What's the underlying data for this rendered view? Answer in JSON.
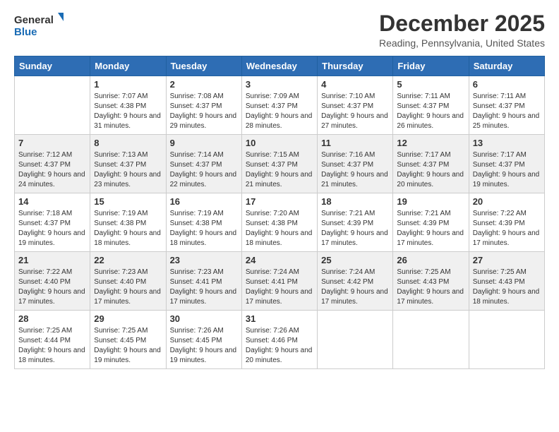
{
  "logo": {
    "line1": "General",
    "line2": "Blue"
  },
  "title": "December 2025",
  "location": "Reading, Pennsylvania, United States",
  "days_of_week": [
    "Sunday",
    "Monday",
    "Tuesday",
    "Wednesday",
    "Thursday",
    "Friday",
    "Saturday"
  ],
  "weeks": [
    [
      {
        "day": "",
        "sunrise": "",
        "sunset": "",
        "daylight": ""
      },
      {
        "day": "1",
        "sunrise": "Sunrise: 7:07 AM",
        "sunset": "Sunset: 4:38 PM",
        "daylight": "Daylight: 9 hours and 31 minutes."
      },
      {
        "day": "2",
        "sunrise": "Sunrise: 7:08 AM",
        "sunset": "Sunset: 4:37 PM",
        "daylight": "Daylight: 9 hours and 29 minutes."
      },
      {
        "day": "3",
        "sunrise": "Sunrise: 7:09 AM",
        "sunset": "Sunset: 4:37 PM",
        "daylight": "Daylight: 9 hours and 28 minutes."
      },
      {
        "day": "4",
        "sunrise": "Sunrise: 7:10 AM",
        "sunset": "Sunset: 4:37 PM",
        "daylight": "Daylight: 9 hours and 27 minutes."
      },
      {
        "day": "5",
        "sunrise": "Sunrise: 7:11 AM",
        "sunset": "Sunset: 4:37 PM",
        "daylight": "Daylight: 9 hours and 26 minutes."
      },
      {
        "day": "6",
        "sunrise": "Sunrise: 7:11 AM",
        "sunset": "Sunset: 4:37 PM",
        "daylight": "Daylight: 9 hours and 25 minutes."
      }
    ],
    [
      {
        "day": "7",
        "sunrise": "Sunrise: 7:12 AM",
        "sunset": "Sunset: 4:37 PM",
        "daylight": "Daylight: 9 hours and 24 minutes."
      },
      {
        "day": "8",
        "sunrise": "Sunrise: 7:13 AM",
        "sunset": "Sunset: 4:37 PM",
        "daylight": "Daylight: 9 hours and 23 minutes."
      },
      {
        "day": "9",
        "sunrise": "Sunrise: 7:14 AM",
        "sunset": "Sunset: 4:37 PM",
        "daylight": "Daylight: 9 hours and 22 minutes."
      },
      {
        "day": "10",
        "sunrise": "Sunrise: 7:15 AM",
        "sunset": "Sunset: 4:37 PM",
        "daylight": "Daylight: 9 hours and 21 minutes."
      },
      {
        "day": "11",
        "sunrise": "Sunrise: 7:16 AM",
        "sunset": "Sunset: 4:37 PM",
        "daylight": "Daylight: 9 hours and 21 minutes."
      },
      {
        "day": "12",
        "sunrise": "Sunrise: 7:17 AM",
        "sunset": "Sunset: 4:37 PM",
        "daylight": "Daylight: 9 hours and 20 minutes."
      },
      {
        "day": "13",
        "sunrise": "Sunrise: 7:17 AM",
        "sunset": "Sunset: 4:37 PM",
        "daylight": "Daylight: 9 hours and 19 minutes."
      }
    ],
    [
      {
        "day": "14",
        "sunrise": "Sunrise: 7:18 AM",
        "sunset": "Sunset: 4:37 PM",
        "daylight": "Daylight: 9 hours and 19 minutes."
      },
      {
        "day": "15",
        "sunrise": "Sunrise: 7:19 AM",
        "sunset": "Sunset: 4:38 PM",
        "daylight": "Daylight: 9 hours and 18 minutes."
      },
      {
        "day": "16",
        "sunrise": "Sunrise: 7:19 AM",
        "sunset": "Sunset: 4:38 PM",
        "daylight": "Daylight: 9 hours and 18 minutes."
      },
      {
        "day": "17",
        "sunrise": "Sunrise: 7:20 AM",
        "sunset": "Sunset: 4:38 PM",
        "daylight": "Daylight: 9 hours and 18 minutes."
      },
      {
        "day": "18",
        "sunrise": "Sunrise: 7:21 AM",
        "sunset": "Sunset: 4:39 PM",
        "daylight": "Daylight: 9 hours and 17 minutes."
      },
      {
        "day": "19",
        "sunrise": "Sunrise: 7:21 AM",
        "sunset": "Sunset: 4:39 PM",
        "daylight": "Daylight: 9 hours and 17 minutes."
      },
      {
        "day": "20",
        "sunrise": "Sunrise: 7:22 AM",
        "sunset": "Sunset: 4:39 PM",
        "daylight": "Daylight: 9 hours and 17 minutes."
      }
    ],
    [
      {
        "day": "21",
        "sunrise": "Sunrise: 7:22 AM",
        "sunset": "Sunset: 4:40 PM",
        "daylight": "Daylight: 9 hours and 17 minutes."
      },
      {
        "day": "22",
        "sunrise": "Sunrise: 7:23 AM",
        "sunset": "Sunset: 4:40 PM",
        "daylight": "Daylight: 9 hours and 17 minutes."
      },
      {
        "day": "23",
        "sunrise": "Sunrise: 7:23 AM",
        "sunset": "Sunset: 4:41 PM",
        "daylight": "Daylight: 9 hours and 17 minutes."
      },
      {
        "day": "24",
        "sunrise": "Sunrise: 7:24 AM",
        "sunset": "Sunset: 4:41 PM",
        "daylight": "Daylight: 9 hours and 17 minutes."
      },
      {
        "day": "25",
        "sunrise": "Sunrise: 7:24 AM",
        "sunset": "Sunset: 4:42 PM",
        "daylight": "Daylight: 9 hours and 17 minutes."
      },
      {
        "day": "26",
        "sunrise": "Sunrise: 7:25 AM",
        "sunset": "Sunset: 4:43 PM",
        "daylight": "Daylight: 9 hours and 17 minutes."
      },
      {
        "day": "27",
        "sunrise": "Sunrise: 7:25 AM",
        "sunset": "Sunset: 4:43 PM",
        "daylight": "Daylight: 9 hours and 18 minutes."
      }
    ],
    [
      {
        "day": "28",
        "sunrise": "Sunrise: 7:25 AM",
        "sunset": "Sunset: 4:44 PM",
        "daylight": "Daylight: 9 hours and 18 minutes."
      },
      {
        "day": "29",
        "sunrise": "Sunrise: 7:25 AM",
        "sunset": "Sunset: 4:45 PM",
        "daylight": "Daylight: 9 hours and 19 minutes."
      },
      {
        "day": "30",
        "sunrise": "Sunrise: 7:26 AM",
        "sunset": "Sunset: 4:45 PM",
        "daylight": "Daylight: 9 hours and 19 minutes."
      },
      {
        "day": "31",
        "sunrise": "Sunrise: 7:26 AM",
        "sunset": "Sunset: 4:46 PM",
        "daylight": "Daylight: 9 hours and 20 minutes."
      },
      {
        "day": "",
        "sunrise": "",
        "sunset": "",
        "daylight": ""
      },
      {
        "day": "",
        "sunrise": "",
        "sunset": "",
        "daylight": ""
      },
      {
        "day": "",
        "sunrise": "",
        "sunset": "",
        "daylight": ""
      }
    ]
  ]
}
